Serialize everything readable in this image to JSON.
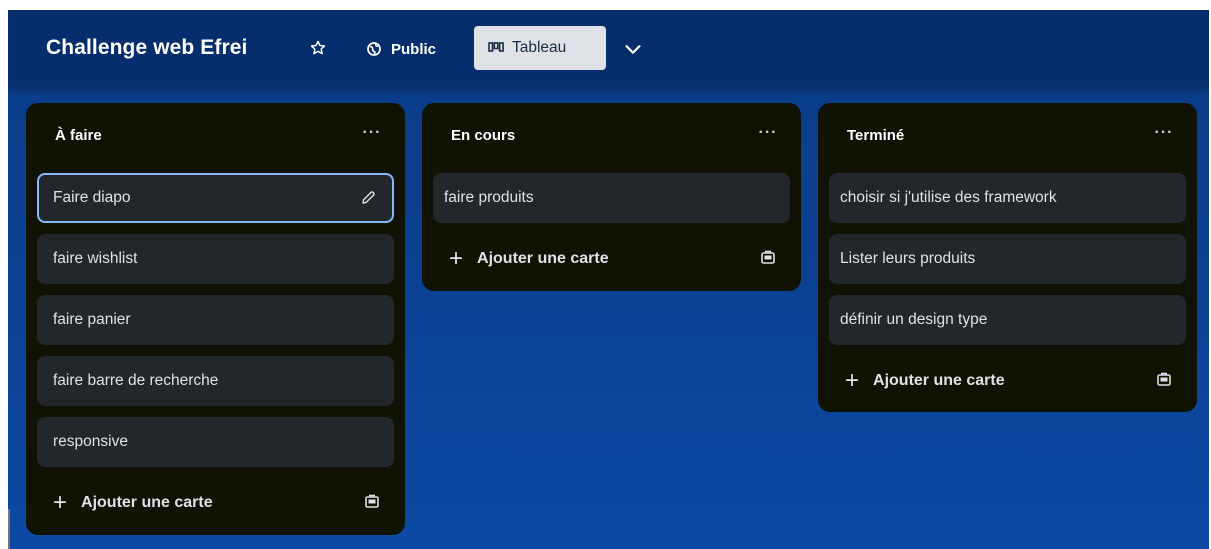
{
  "board": {
    "title": "Challenge web Efrei",
    "visibility": "Public",
    "view": "Tableau"
  },
  "colors": {
    "background": "#0b3f8f",
    "list_bg": "#101204",
    "card_bg": "#22272b",
    "active_border": "#85b8ff"
  },
  "icons": [
    "star-icon",
    "globe-icon",
    "board-view-icon",
    "chevron-down-icon",
    "more-icon",
    "pencil-icon",
    "plus-icon",
    "card-template-icon"
  ],
  "lists": [
    {
      "title": "À faire",
      "cards": [
        "Faire diapo",
        "faire wishlist",
        "faire panier",
        "faire barre de recherche",
        "responsive"
      ],
      "add_label": "Ajouter une carte"
    },
    {
      "title": "En cours",
      "cards": [
        "faire produits"
      ],
      "add_label": "Ajouter une carte"
    },
    {
      "title": "Terminé",
      "cards": [
        "choisir si j'utilise des framework",
        "Lister leurs produits",
        "définir un design type"
      ],
      "add_label": "Ajouter une carte"
    }
  ]
}
